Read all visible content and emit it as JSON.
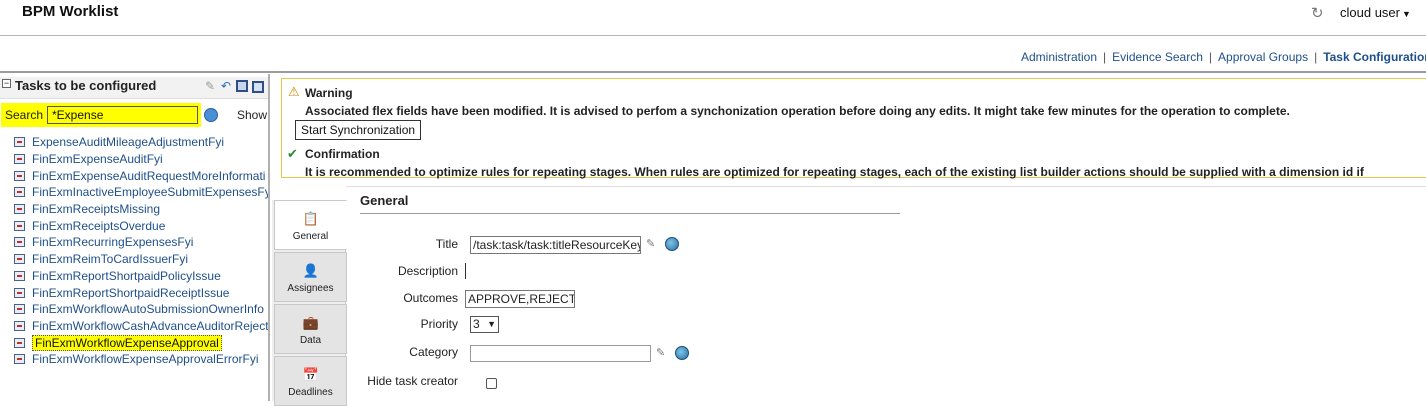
{
  "header": {
    "app_title": "BPM Worklist",
    "user": "cloud user"
  },
  "top_links": [
    "Administration",
    "Evidence Search",
    "Approval Groups",
    "Task Configuration"
  ],
  "left_panel": {
    "title": "Tasks to be configured",
    "search_label": "Search",
    "search_value": "*Expense",
    "show_label": "Show",
    "tasks": [
      "ExpenseAuditMileageAdjustmentFyi",
      "FinExmExpenseAuditFyi",
      "FinExmExpenseAuditRequestMoreInformati",
      "FinExmInactiveEmployeeSubmitExpensesFy",
      "FinExmReceiptsMissing",
      "FinExmReceiptsOverdue",
      "FinExmRecurringExpensesFyi",
      "FinExmReimToCardIssuerFyi",
      "FinExmReportShortpaidPolicyIssue",
      "FinExmReportShortpaidReceiptIssue",
      "FinExmWorkflowAutoSubmissionOwnerInfo",
      "FinExmWorkflowCashAdvanceAuditorReject",
      "FinExmWorkflowExpenseApproval",
      "FinExmWorkflowExpenseApprovalErrorFyi"
    ],
    "selected_index": 12
  },
  "messages": {
    "warning_title": "Warning",
    "warning_text": "Associated flex fields have been modified. It is advised to perfom a synchonization operation before doing any edits. It might take few minutes for the operation to complete.",
    "sync_button": "Start Synchronization",
    "confirm_title": "Confirmation",
    "confirm_text": "It is recommended to optimize rules for repeating stages. When rules are optimized for repeating stages, each of the existing list builder actions should be supplied with a dimension id if"
  },
  "tabs": [
    "General",
    "Assignees",
    "Data",
    "Deadlines"
  ],
  "general": {
    "section_title": "General",
    "title_label": "Title",
    "title_value": "/task:task/task:titleResourceKey",
    "description_label": "Description",
    "description_value": "",
    "outcomes_label": "Outcomes",
    "outcomes_value": "APPROVE,REJECT",
    "priority_label": "Priority",
    "priority_value": "3",
    "category_label": "Category",
    "category_value": "",
    "hide_creator_label": "Hide task creator",
    "hide_creator_checked": false
  },
  "colors": {
    "link": "#1f4f8a",
    "highlight": "#ffff00",
    "warning_border": "#e5c84a"
  }
}
